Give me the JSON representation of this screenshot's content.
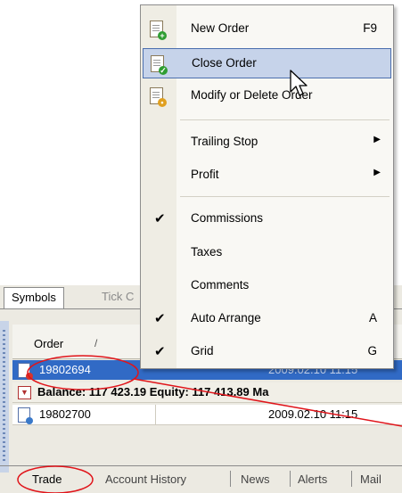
{
  "context_menu": {
    "items": [
      {
        "label": "New Order",
        "shortcut": "F9",
        "icon": "new-order-icon"
      },
      {
        "label": "Close Order",
        "shortcut": "",
        "icon": "close-order-icon"
      },
      {
        "label": "Modify or Delete Order",
        "shortcut": "",
        "icon": "modify-order-icon"
      },
      {
        "label": "Trailing Stop",
        "submenu": true
      },
      {
        "label": "Profit",
        "submenu": true
      },
      {
        "label": "Commissions",
        "checked": true
      },
      {
        "label": "Taxes",
        "checked": false
      },
      {
        "label": "Comments",
        "checked": false
      },
      {
        "label": "Auto Arrange",
        "shortcut": "A",
        "checked": true
      },
      {
        "label": "Grid",
        "shortcut": "G",
        "checked": true
      }
    ],
    "hovered": "Close Order"
  },
  "symbols_tabs": [
    "Symbols",
    "Tick C"
  ],
  "grid": {
    "columns": {
      "order": "Order",
      "sort": "/"
    },
    "rows": [
      {
        "ticket": "19802694",
        "time": "2009.02.10 11:15",
        "selected": true
      },
      {
        "balance": "Balance: 117 423.19  Equity: 117 413.89  Ma"
      },
      {
        "ticket": "19802700",
        "time": "2009.02.10 11:15",
        "selected": false
      }
    ]
  },
  "bottom_tabs": [
    "Trade",
    "Account History",
    "News",
    "Alerts",
    "Mail"
  ],
  "colors": {
    "selection": "#316ac5",
    "menu_hover": "#c6d3ea",
    "annotation": "#e0141a"
  }
}
